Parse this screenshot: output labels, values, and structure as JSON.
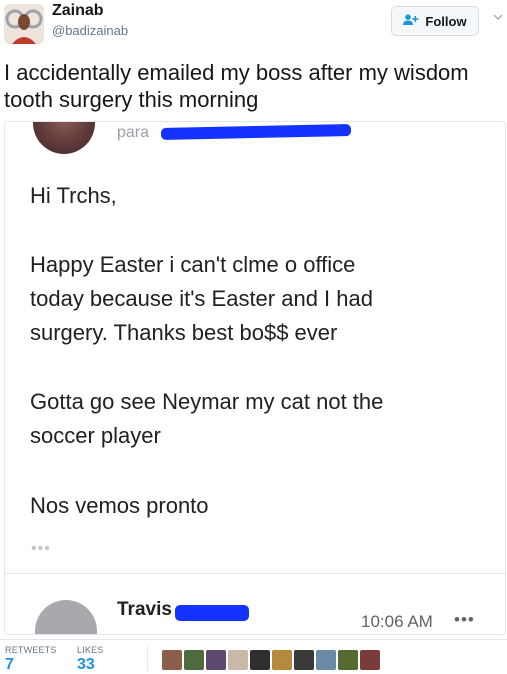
{
  "user": {
    "display_name": "Zainab",
    "handle": "@badizainab"
  },
  "follow_button": {
    "label": "Follow",
    "icon": "add-user-icon"
  },
  "tweet": {
    "text": "I accidentally emailed my boss after my wisdom tooth surgery this morning"
  },
  "media": {
    "header_prefix": "para",
    "greeting": "Hi Trchs,",
    "paragraph1": [
      "Happy Easter i can't clme o office",
      "today because it's Easter and I had",
      "surgery. Thanks  best bo$$ ever"
    ],
    "paragraph2": [
      "Gotta go see Neymar my cat not the",
      "soccer player"
    ],
    "paragraph3": "Nos vemos pronto",
    "ellipsis": "•••",
    "reply": {
      "name": "Travis",
      "time": "10:06 AM",
      "more": "•••"
    }
  },
  "stats": {
    "retweets_label": "RETWEETS",
    "retweets_value": "7",
    "likes_label": "LIKES",
    "likes_value": "33",
    "liker_colors": [
      "#8b5e4a",
      "#4d6b3c",
      "#5d4a6e",
      "#c9b8a6",
      "#2f2f2f",
      "#b58a3c",
      "#3a3a3a",
      "#6b8aa8",
      "#556b2f",
      "#7a3b3b"
    ]
  },
  "colors": {
    "accent": "#1b95e0",
    "redaction": "#1433ff"
  }
}
